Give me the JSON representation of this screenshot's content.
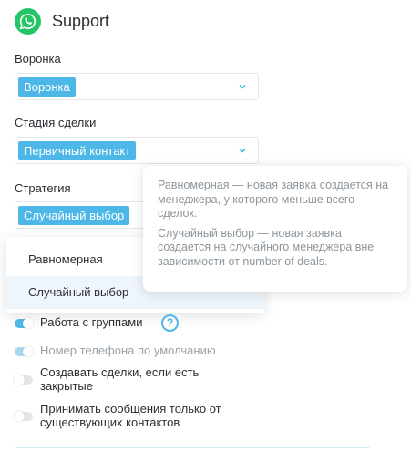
{
  "header": {
    "title": "Support",
    "icon": "whatsapp-icon",
    "icon_color": "#25c565"
  },
  "funnel": {
    "label": "Воронка",
    "value": "Воронка"
  },
  "stage": {
    "label": "Стадия сделки",
    "value": "Первичный контакт"
  },
  "strategy": {
    "label": "Стратегия",
    "value": "Случайный выбор",
    "options": [
      "Равномерная",
      "Случайный выбор"
    ]
  },
  "tooltip": {
    "line1": "Равномерная — новая заявка создается на менеджера, у которого меньше всего сделок.",
    "line2": "Случайный выбор — новая заявка создается на случайного менеджера вне зависимости от number of deals."
  },
  "toggles": [
    {
      "label": "Работа с группами",
      "state": "on"
    },
    {
      "label": "Номер телефона по умолчанию",
      "state": "on-disabled"
    },
    {
      "label": "Создавать сделки, если есть закрытые",
      "state": "off"
    },
    {
      "label": "Принимать сообщения только от существующих контактов",
      "state": "off"
    }
  ],
  "help_icon": {
    "glyph": "?"
  },
  "colors": {
    "accent": "#4db8e8",
    "whatsapp": "#25c565",
    "border": "#e3e7ea"
  }
}
